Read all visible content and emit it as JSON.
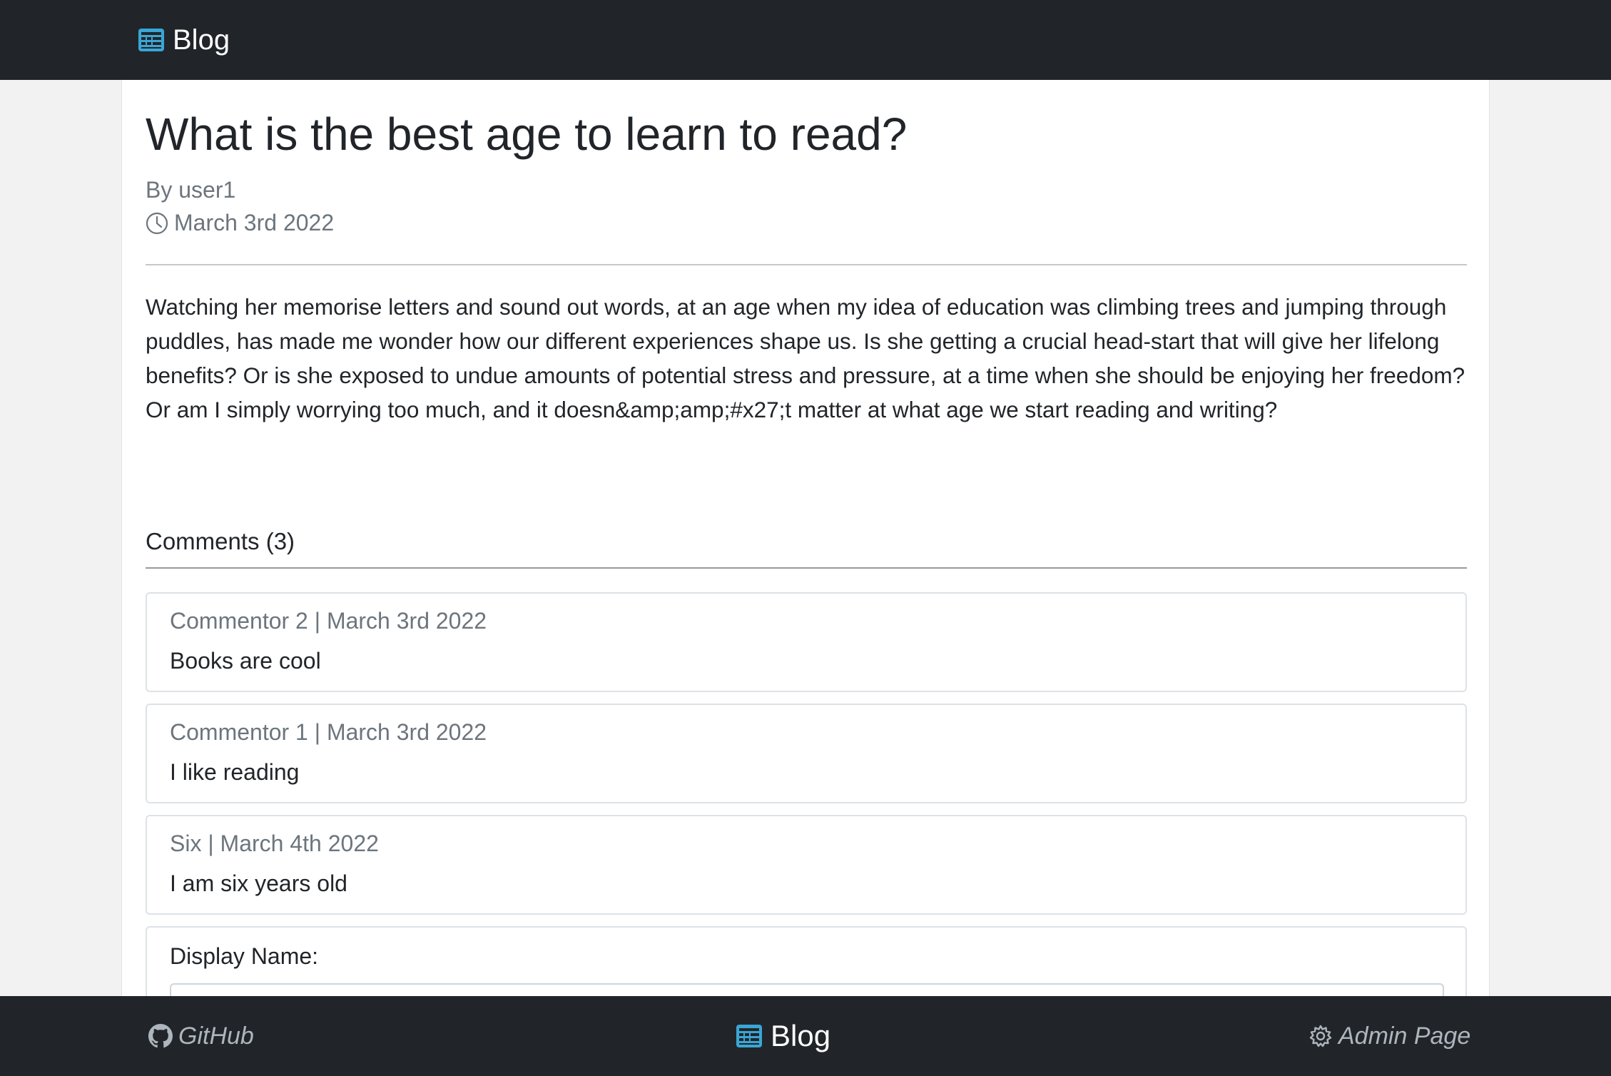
{
  "navbar": {
    "brand": "Blog",
    "brand_icon": "newspaper-icon",
    "brand_icon_color": "#3aa6d6"
  },
  "post": {
    "title": "What is the best age to learn to read?",
    "author": "By user1",
    "date": "March 3rd 2022",
    "date_icon": "clock-icon",
    "body": "Watching her memorise letters and sound out words, at an age when my idea of education was climbing trees and jumping through puddles, has made me wonder how our different experiences shape us. Is she getting a crucial head-start that will give her lifelong benefits? Or is she exposed to undue amounts of potential stress and pressure, at a time when she should be enjoying her freedom? Or am I simply worrying too much, and it doesn&amp;amp;#x27;t matter at what age we start reading and writing?"
  },
  "comments": {
    "heading": "Comments (3)",
    "items": [
      {
        "meta": "Commentor 2 | March 3rd 2022",
        "text": "Books are cool"
      },
      {
        "meta": "Commentor 1 | March 3rd 2022",
        "text": "I like reading"
      },
      {
        "meta": "Six | March 4th 2022",
        "text": "I am six years old"
      }
    ]
  },
  "form": {
    "display_name_label": "Display Name:",
    "display_name_value": ""
  },
  "footer": {
    "github_label": "GitHub",
    "github_icon": "github-icon",
    "brand": "Blog",
    "admin_label": "Admin Page",
    "admin_icon": "gear-icon"
  },
  "colors": {
    "dark_bar": "#212529",
    "muted_text": "#6c757d",
    "accent": "#3aa6d6"
  }
}
